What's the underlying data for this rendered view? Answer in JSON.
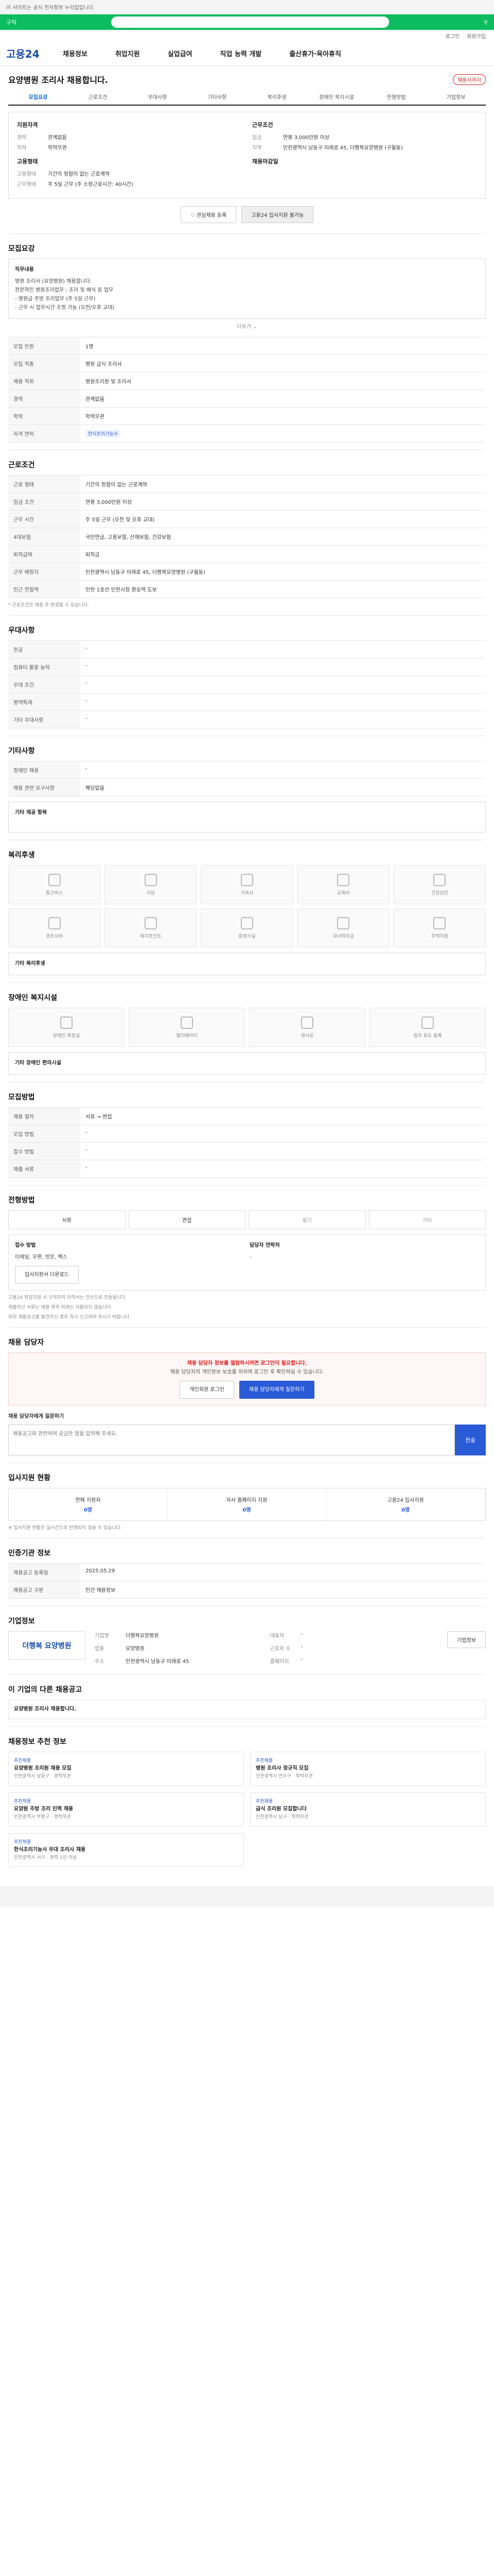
{
  "top": {
    "notice": "이 사이트는 공식 전자정부 누리집입니다.",
    "search_label": "구직",
    "util_links": [
      "로그인",
      "회원가입"
    ]
  },
  "gnb": {
    "logo": "고용24",
    "menu": [
      "채용정보",
      "취업지원",
      "실업급여",
      "직업 능력 개발",
      "출산휴가·육아휴직"
    ]
  },
  "title": {
    "text": "요양병원 조리사 채용합니다.",
    "badge": "채용시까지"
  },
  "tabs": [
    "모집요강",
    "근로조건",
    "우대사항",
    "기타사항",
    "복리후생",
    "장애인 복지시설",
    "전형방법",
    "기업정보"
  ],
  "summary": {
    "left_heading": "지원자격",
    "left": [
      {
        "k": "경력",
        "v": "관계없음"
      },
      {
        "k": "학력",
        "v": "학력무관"
      }
    ],
    "left2_heading": "고용형태",
    "left2": [
      {
        "k": "고용형태",
        "v": "기간의 정함이 없는 근로계약"
      },
      {
        "k": "근무형태",
        "v": "주 5일 근무 (주 소정근로시간: 40시간)"
      }
    ],
    "right_heading": "근무조건",
    "right": [
      {
        "k": "임금",
        "v": "연봉 3,000만원 이상"
      },
      {
        "k": "지역",
        "v": "인천광역시 남동구 미래로 45, 더행복요양병원 (구월동)"
      }
    ],
    "right2_heading": "채용마감일"
  },
  "buttons": {
    "scrap": "관심채용 등록",
    "mail": "고용24 입사지원 불가능"
  },
  "section_recruit": {
    "heading": "모집요강",
    "duty_head": "직무내용",
    "duty_lines": [
      "병원 조리사 (요양병원) 채용합니다.",
      "전문적인 병원조리업무 : 조리 및 배식 등 업무",
      "",
      "- 병원급 주방 조리업무 (주 5일 근무)",
      "- 근무 시 업무시간 조정 가능 (오전/오후 교대)"
    ],
    "more": "더보기",
    "rows": [
      {
        "th": "모집 인원",
        "td": "1명"
      },
      {
        "th": "모집 직종",
        "td": "병원 급식 조리사"
      },
      {
        "th": "채용 직위",
        "td": "병원조리원 및 조리사"
      },
      {
        "th": "경력",
        "td": "관계없음"
      },
      {
        "th": "학력",
        "td": "학력무관"
      },
      {
        "th": "자격 면허",
        "td": "한식조리기능사"
      }
    ]
  },
  "section_cond": {
    "heading": "근로조건",
    "rows": [
      {
        "th": "근로 형태",
        "td": "기간의 정함이 없는 근로계약"
      },
      {
        "th": "임금 조건",
        "td": "연봉 3,000만원 이상"
      },
      {
        "th": "근무 시간",
        "td": "주 5일 근무 (오전 및 오후 교대)"
      },
      {
        "th": "4대보험",
        "td": "국민연금, 고용보험, 산재보험, 건강보험"
      },
      {
        "th": "퇴직급여",
        "td": "퇴직금"
      },
      {
        "th": "근무 예정지",
        "td": "인천광역시 남동구 미래로 45, 더행복요양병원 (구월동)"
      },
      {
        "th": "인근 전철역",
        "td": "인천 1호선 인천시청 환승역 도보"
      }
    ],
    "note": "* 근로조건은 채용 후 변경될 수 있습니다."
  },
  "section_pref": {
    "heading": "우대사항",
    "rows": [
      {
        "th": "전공",
        "td": "-"
      },
      {
        "th": "컴퓨터 활용 능력",
        "td": "-"
      },
      {
        "th": "우대 조건",
        "td": "-"
      },
      {
        "th": "병역특례",
        "td": "-"
      },
      {
        "th": "기타 우대사항",
        "td": "-"
      }
    ]
  },
  "section_etc": {
    "heading": "기타사항",
    "rows": [
      {
        "th": "장애인 채용",
        "td": "-"
      },
      {
        "th": "채용 관련 요구사항",
        "td": "해당없음"
      }
    ],
    "extra": "기타 제공 항목"
  },
  "section_welfare": {
    "heading": "복리후생",
    "items": [
      "통근버스",
      "식당",
      "기숙사",
      "교육비",
      "건강검진",
      "경조사비",
      "복지포인트",
      "휴양시설",
      "자녀학자금",
      "주택지원"
    ],
    "extra_label": "기타 복리후생"
  },
  "section_disabled": {
    "heading": "장애인 복지시설",
    "items": [
      "장애인 화장실",
      "엘리베이터",
      "경사로",
      "점자 유도 블록"
    ],
    "extra_label": "기타 장애인 편의시설"
  },
  "section_apply": {
    "heading": "모집방법",
    "rows": [
      {
        "th": "채용 절차",
        "td": "서류 → 면접"
      },
      {
        "th": "모집 방법",
        "td": "-"
      },
      {
        "th": "접수 방법",
        "td": "-"
      },
      {
        "th": "제출 서류",
        "td": "-"
      }
    ]
  },
  "section_select": {
    "heading": "전형방법",
    "methods": [
      "서류",
      "면접",
      "필기",
      "기타"
    ],
    "doc_head": "접수 방법",
    "doc_value": "이메일, 우편, 방문, 팩스",
    "contact_head": "담당자 연락처",
    "contact_value": "-",
    "print_btn": "입사지원서 다운로드",
    "notes": [
      "고용24 취업지원 시 구직자의 이력서는 전산으로 전송됩니다.",
      "제출하신 서류는 채용 목적 외에는 사용되지 않습니다.",
      "허위 채용공고를 발견하신 경우 즉시 신고하여 주시기 바랍니다."
    ]
  },
  "section_qa": {
    "heading": "채용 담당자",
    "alert_title": "채용 담당자 정보를 열람하시려면 로그인이 필요합니다.",
    "alert_body": "채용 담당자의 개인정보 보호를 위하여 로그인 후 확인하실 수 있습니다.",
    "btn_login": "개인회원 로그인",
    "btn_join": "채용 담당자에게 질문하기",
    "qa_label": "채용 담당자에게 질문하기",
    "qa_placeholder": "채용공고와 관련하여 궁금한 점을 입력해 주세요.",
    "qa_send": "전송"
  },
  "section_stats": {
    "heading": "입사지원 현황",
    "items": [
      {
        "label": "전체 지원자",
        "value": "0명"
      },
      {
        "label": "자사 홈페이지 지원",
        "value": "0명"
      },
      {
        "label": "고용24 입사지원",
        "value": "0명"
      }
    ],
    "note": "※ 입사지원 현황은 실시간으로 반영되지 않을 수 있습니다."
  },
  "section_job": {
    "heading": "인증기관 정보",
    "rows": [
      {
        "th": "채용공고 등록일",
        "td": "2025.05.29"
      },
      {
        "th": "채용공고 구분",
        "td": "민간 채용정보"
      }
    ]
  },
  "section_company": {
    "heading": "기업정보",
    "logo": "더행복 요양병원",
    "kv": [
      {
        "k": "기업명",
        "v": "더행복요양병원"
      },
      {
        "k": "대표자",
        "v": "-"
      },
      {
        "k": "업종",
        "v": "요양병원"
      },
      {
        "k": "근로자 수",
        "v": "-"
      },
      {
        "k": "주소",
        "v": "인천광역시 남동구 미래로 45"
      },
      {
        "k": "홈페이지",
        "v": "-"
      }
    ],
    "more": "기업정보"
  },
  "section_recent": {
    "heading": "이 기업의 다른 채용공고",
    "title": "요양병원 조리사 채용합니다."
  },
  "section_other": {
    "heading": "채용정보 추천 정보",
    "cards": [
      {
        "cat": "추천채용",
        "t": "요양병원 조리원 채용 모집",
        "m": "인천광역시 남동구 · 경력무관"
      },
      {
        "cat": "추천채용",
        "t": "병원 조리사 정규직 모집",
        "m": "인천광역시 연수구 · 학력무관"
      },
      {
        "cat": "추천채용",
        "t": "요양원 주방 조리 인력 채용",
        "m": "인천광역시 부평구 · 경력무관"
      },
      {
        "cat": "추천채용",
        "t": "급식 조리원 모집합니다",
        "m": "인천광역시 남구 · 학력무관"
      },
      {
        "cat": "추천채용",
        "t": "한식조리기능사 우대 조리사 채용",
        "m": "인천광역시 서구 · 경력 1년 이상"
      }
    ]
  }
}
